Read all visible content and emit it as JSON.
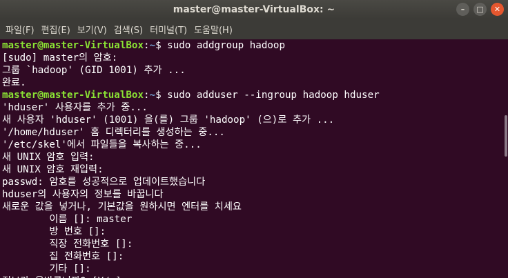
{
  "window": {
    "title": "master@master-VirtualBox: ~",
    "minimize_label": "–",
    "maximize_label": "□",
    "close_label": "✕"
  },
  "menu": [
    {
      "label": "파일(F)"
    },
    {
      "label": "편집(E)"
    },
    {
      "label": "보기(V)"
    },
    {
      "label": "검색(S)"
    },
    {
      "label": "터미널(T)"
    },
    {
      "label": "도움말(H)"
    }
  ],
  "terminal": {
    "lines": [
      {
        "user": "master@master-VirtualBox",
        "sep": ":",
        "path": "~",
        "text": "$ sudo addgroup hadoop"
      },
      {
        "text": "[sudo] master의 암호:"
      },
      {
        "text": "그룹 `hadoop' (GID 1001) 추가 ..."
      },
      {
        "text": "완료."
      },
      {
        "user": "master@master-VirtualBox",
        "sep": ":",
        "path": "~",
        "text": "$ sudo adduser --ingroup hadoop hduser"
      },
      {
        "text": "'hduser' 사용자를 추가 중..."
      },
      {
        "text": "새 사용자 'hduser' (1001) 을(를) 그룹 'hadoop' (으)로 추가 ..."
      },
      {
        "text": "'/home/hduser' 홈 디렉터리를 생성하는 중..."
      },
      {
        "text": "'/etc/skel'에서 파일들을 복사하는 중..."
      },
      {
        "text": "새 UNIX 암호 입력:"
      },
      {
        "text": "새 UNIX 암호 재입력:"
      },
      {
        "text": "passwd: 암호를 성공적으로 업데이트했습니다"
      },
      {
        "text": "hduser의 사용자의 정보를 바꿉니다"
      },
      {
        "text": "새로운 값을 넣거나, 기본값을 원하시면 엔터를 치세요"
      },
      {
        "text": "        이름 []: master"
      },
      {
        "text": "        방 번호 []:"
      },
      {
        "text": "        직장 전화번호 []:"
      },
      {
        "text": "        집 전화번호 []:"
      },
      {
        "text": "        기타 []:"
      },
      {
        "text": "정보가 올바릅니까? [Y/n]"
      }
    ]
  }
}
